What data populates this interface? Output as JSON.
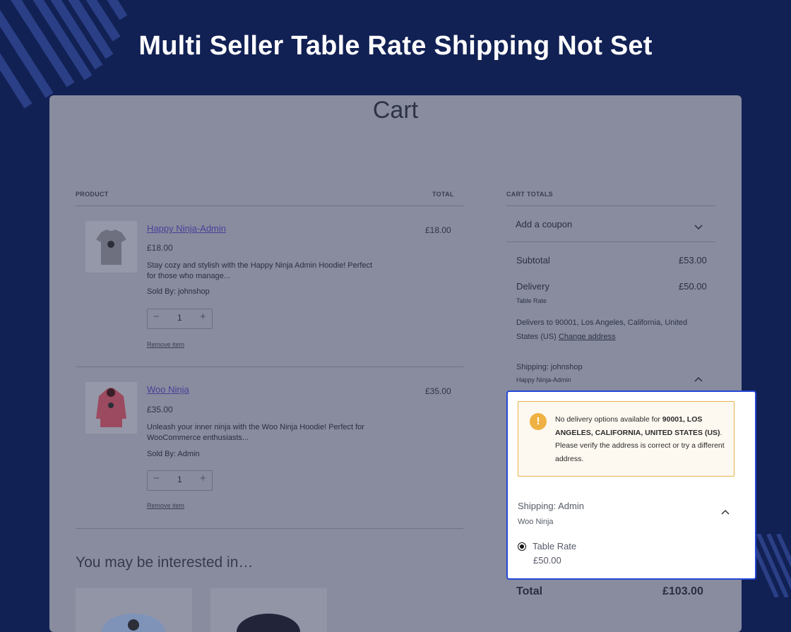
{
  "banner": {
    "title": "Multi Seller Table Rate Shipping Not Set"
  },
  "cart": {
    "title": "Cart",
    "headers": {
      "product": "PRODUCT",
      "total": "TOTAL",
      "cart_totals": "CART TOTALS"
    },
    "items": [
      {
        "name": "Happy Ninja-Admin",
        "price": "£18.00",
        "description": "Stay cozy and stylish with the Happy Ninja Admin Hoodie! Perfect for those who manage...",
        "sold_by_label": "Sold By:",
        "seller": "johnshop",
        "quantity": "1",
        "minus": "−",
        "plus": "+",
        "remove": "Remove item",
        "line_total": "£18.00",
        "image": "grey-tshirt"
      },
      {
        "name": "Woo Ninja",
        "price": "£35.00",
        "description": "Unleash your inner ninja with the Woo Ninja Hoodie! Perfect for WooCommerce enthusiasts...",
        "sold_by_label": "Sold By:",
        "seller": "Admin",
        "quantity": "1",
        "minus": "−",
        "plus": "+",
        "remove": "Remove item",
        "line_total": "£35.00",
        "image": "pink-hoodie"
      }
    ],
    "interested": "You may be interested in…"
  },
  "totals": {
    "coupon": "Add a coupon",
    "subtotal_label": "Subtotal",
    "subtotal_value": "£53.00",
    "delivery_label": "Delivery",
    "delivery_value": "£50.00",
    "delivery_method": "Table Rate",
    "delivers_to": "Delivers to 90001, Los Angeles, California, United States (US)",
    "change_address": "Change address",
    "shipping_john": "Shipping: johnshop",
    "shipping_john_item": "Happy Ninja-Admin",
    "total_label": "Total",
    "total_value": "£103.00"
  },
  "popup": {
    "notice_prefix": "No delivery options available for",
    "notice_address": "90001, LOS ANGELES, CALIFORNIA, UNITED STATES (US)",
    "notice_suffix": ". Please verify the address is correct or try a different address.",
    "shipping_admin": "Shipping: Admin",
    "shipping_admin_item": "Woo Ninja",
    "rate_label": "Table Rate",
    "rate_price": "£50.00",
    "rate_selected": true
  },
  "colors": {
    "background": "#122154",
    "overlay": "#888c9e",
    "highlight_border": "#2447d6",
    "notice_border": "#e7b34a",
    "notice_icon": "#efb143",
    "link": "#4b3f9a"
  }
}
